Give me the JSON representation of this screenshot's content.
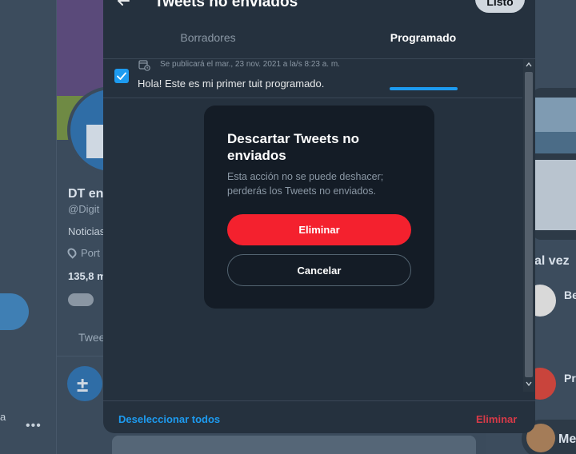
{
  "background": {
    "left_text": "a",
    "left_more": "•••",
    "profile_name": "DT en",
    "profile_handle": "@Digit",
    "profile_bio": "Noticias",
    "profile_location": "Port",
    "profile_count": "135,8 m",
    "profile_tab": "Twee",
    "right_title": "al vez",
    "right_name_1": "Be",
    "right_name_2": "Pr",
    "right_name_3": "Me"
  },
  "panel": {
    "title": "Tweets no enviados",
    "done_label": "Listo",
    "tabs": [
      {
        "label": "Borradores"
      },
      {
        "label": "Programado"
      }
    ],
    "scheduled_items": [
      {
        "schedule": "Se publicará el mar., 23 nov. 2021 a la/s 8:23 a. m.",
        "text": "Hola! Este es mi primer tuit programado.",
        "checked": true
      }
    ],
    "footer": {
      "deselect_label": "Deseleccionar todos",
      "delete_label": "Eliminar"
    }
  },
  "dialog": {
    "title": "Descartar Tweets no enviados",
    "body": "Esta acción no se puede deshacer; perderás los Tweets no enviados.",
    "confirm_label": "Eliminar",
    "cancel_label": "Cancelar"
  },
  "colors": {
    "accent": "#1d9bf0",
    "danger": "#f4212e",
    "panel_bg": "#25313e",
    "dialog_bg": "#141c26"
  }
}
